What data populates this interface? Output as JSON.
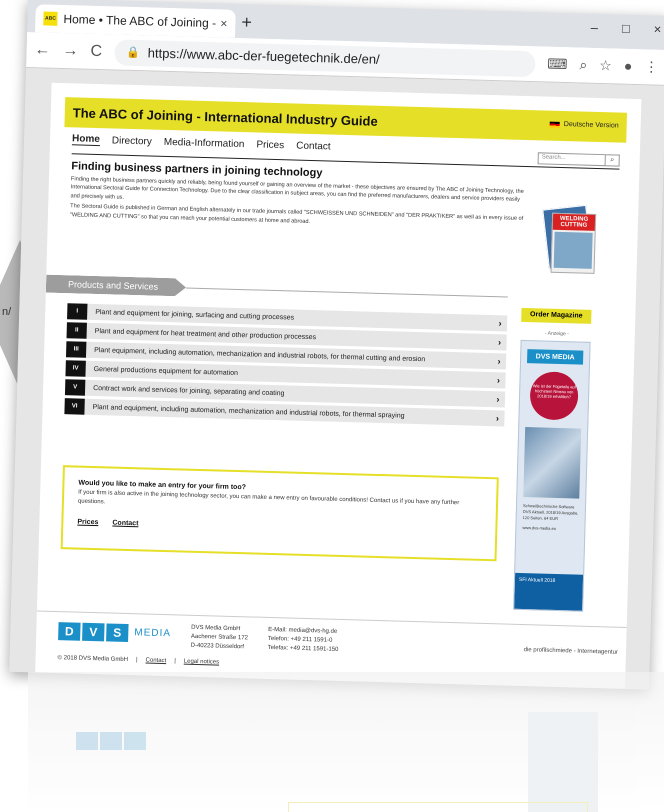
{
  "side": {
    "text": "n/"
  },
  "browser": {
    "tab_title": "Home • The ABC of Joining - Inte",
    "favicon_text": "ABC",
    "tab_close": "×",
    "new_tab": "+",
    "url": "https://www.abc-der-fuegetechnik.de/en/",
    "nav_back": "←",
    "nav_forward": "→",
    "nav_reload": "C",
    "win_min": "–",
    "win_max": "□",
    "win_close": "×"
  },
  "site": {
    "header_title": "The ABC of Joining - International Industry Guide",
    "lang_label": "Deutsche Version",
    "nav": [
      "Home",
      "Directory",
      "Media-Information",
      "Prices",
      "Contact"
    ],
    "search_placeholder": "Search...",
    "intro": {
      "heading": "Finding business partners in joining technology",
      "p1": "Finding the right business partners quickly and reliably, being found yourself or gaining an overview of the market - these objectives are ensured by The ABC of Joining Technology, the International Sectoral Guide for Connection Technology. Due to the clear classification in subject areas, you can find the preferred manufacturers, dealers and service providers easily and precisely with us.",
      "p2": "The Sectoral Guide is published in German and English alternately in our trade journals called \"SCHWEISSEN UND SCHNEIDEN\" and \"DER PRAKTIKER\" as well as in every issue of \"WELDING AND CUTTING\" so that you can reach your potential customers at home and abroad."
    },
    "magazine_title": "WELDING CUTTING",
    "order_button": "Order Magazine",
    "ad_label": "- Anzeige -",
    "ad": {
      "logo": "DVS MEDIA",
      "circle_text": "Wie ist der Fügeteile auf höchstem Niveau von 2018/19 erhältlich?",
      "text": "Schweißtechnische Software DVS Aktuell, 2018/19 Ausgabe, 120 Seiten, 64 EUR",
      "url": "www.dvs-media.eu",
      "bottom": "SFI Aktuell 2018"
    },
    "products_label": "Products and Services",
    "categories": [
      {
        "num": "I",
        "label": "Plant and equipment for joining, surfacing and cutting processes"
      },
      {
        "num": "II",
        "label": "Plant and equipment for heat treatment and other production processes"
      },
      {
        "num": "III",
        "label": "Plant equipment, including automation, mechanization and industrial robots, for thermal cutting and erosion"
      },
      {
        "num": "IV",
        "label": "General productions equipment for automation"
      },
      {
        "num": "V",
        "label": "Contract work and services for joining, separating and coating"
      },
      {
        "num": "VI",
        "label": "Plant and equipment, including automation, mechanization and industrial robots, for thermal spraying"
      }
    ],
    "cat_arrow": "›",
    "entry": {
      "heading": "Would you like to make an entry for your firm too?",
      "text": "If your firm is also active in the joining technology sector, you can make a new entry on favourable conditions! Contact us if you have any further questions.",
      "link_prices": "Prices",
      "link_contact": "Contact"
    },
    "footer": {
      "logo_letters": [
        "D",
        "V",
        "S"
      ],
      "logo_word": "MEDIA",
      "addr1": "DVS Media GmbH",
      "addr2": "Aachener Straße 172",
      "addr3": "D-40223 Düsseldorf",
      "email": "E-Mail: media@dvs-hg.de",
      "phone": "Telefon: +49 211 1591-0",
      "fax": "Telefax: +49 211 1591-150",
      "agency": "die profilschmiede - Internetagentur"
    },
    "copyright": "© 2018 DVS Media GmbH",
    "copy_contact": "Contact",
    "copy_legal": "Legal notices"
  }
}
